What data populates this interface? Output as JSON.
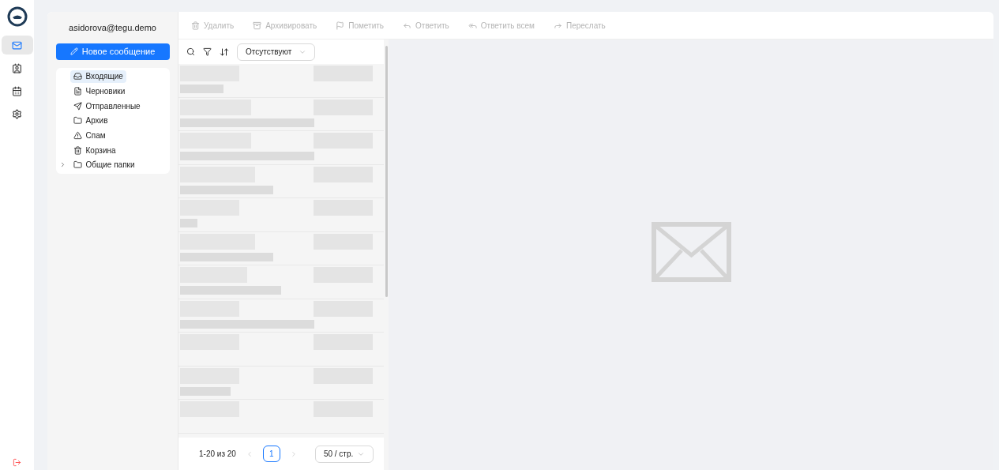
{
  "rail": {
    "items": [
      {
        "kind": "mail",
        "selected": true
      },
      {
        "kind": "contacts",
        "selected": false
      },
      {
        "kind": "calendar",
        "selected": false
      },
      {
        "kind": "settings",
        "selected": false
      }
    ]
  },
  "account": {
    "email": "asidorova@tegu.demo"
  },
  "compose_button": "Новое сообщение",
  "folders": [
    {
      "kind": "inbox",
      "label": "Входящие",
      "selected": true
    },
    {
      "kind": "drafts",
      "label": "Черновики",
      "selected": false
    },
    {
      "kind": "sent",
      "label": "Отправленные",
      "selected": false
    },
    {
      "kind": "folder",
      "label": "Архив",
      "selected": false
    },
    {
      "kind": "spam",
      "label": "Спам",
      "selected": false
    },
    {
      "kind": "trash",
      "label": "Корзина",
      "selected": false
    },
    {
      "kind": "shared",
      "label": "Общие папки",
      "selected": false,
      "expanded": false
    }
  ],
  "toolbar": [
    {
      "kind": "delete",
      "label": "Удалить",
      "disabled": true
    },
    {
      "kind": "archive",
      "label": "Архивировать",
      "disabled": true
    },
    {
      "kind": "flag",
      "label": "Пометить",
      "disabled": true
    },
    {
      "kind": "reply",
      "label": "Ответить",
      "disabled": true
    },
    {
      "kind": "reply_all",
      "label": "Ответить всем",
      "disabled": true
    },
    {
      "kind": "forward",
      "label": "Переслать",
      "disabled": true
    }
  ],
  "filter_select": {
    "value": "Отсутствуют"
  },
  "messages": [
    {
      "kind": "redacted"
    },
    {
      "kind": "redacted"
    },
    {
      "kind": "redacted"
    },
    {
      "kind": "redacted"
    },
    {
      "kind": "redacted"
    },
    {
      "kind": "redacted"
    },
    {
      "kind": "redacted"
    },
    {
      "kind": "redacted"
    },
    {
      "kind": "redacted"
    },
    {
      "kind": "redacted"
    },
    {
      "kind": "redacted"
    }
  ],
  "pagination": {
    "range": "1-20 из 20",
    "pages": [
      {
        "label": "1",
        "selected": true
      }
    ],
    "page_size": "50 / стр."
  }
}
